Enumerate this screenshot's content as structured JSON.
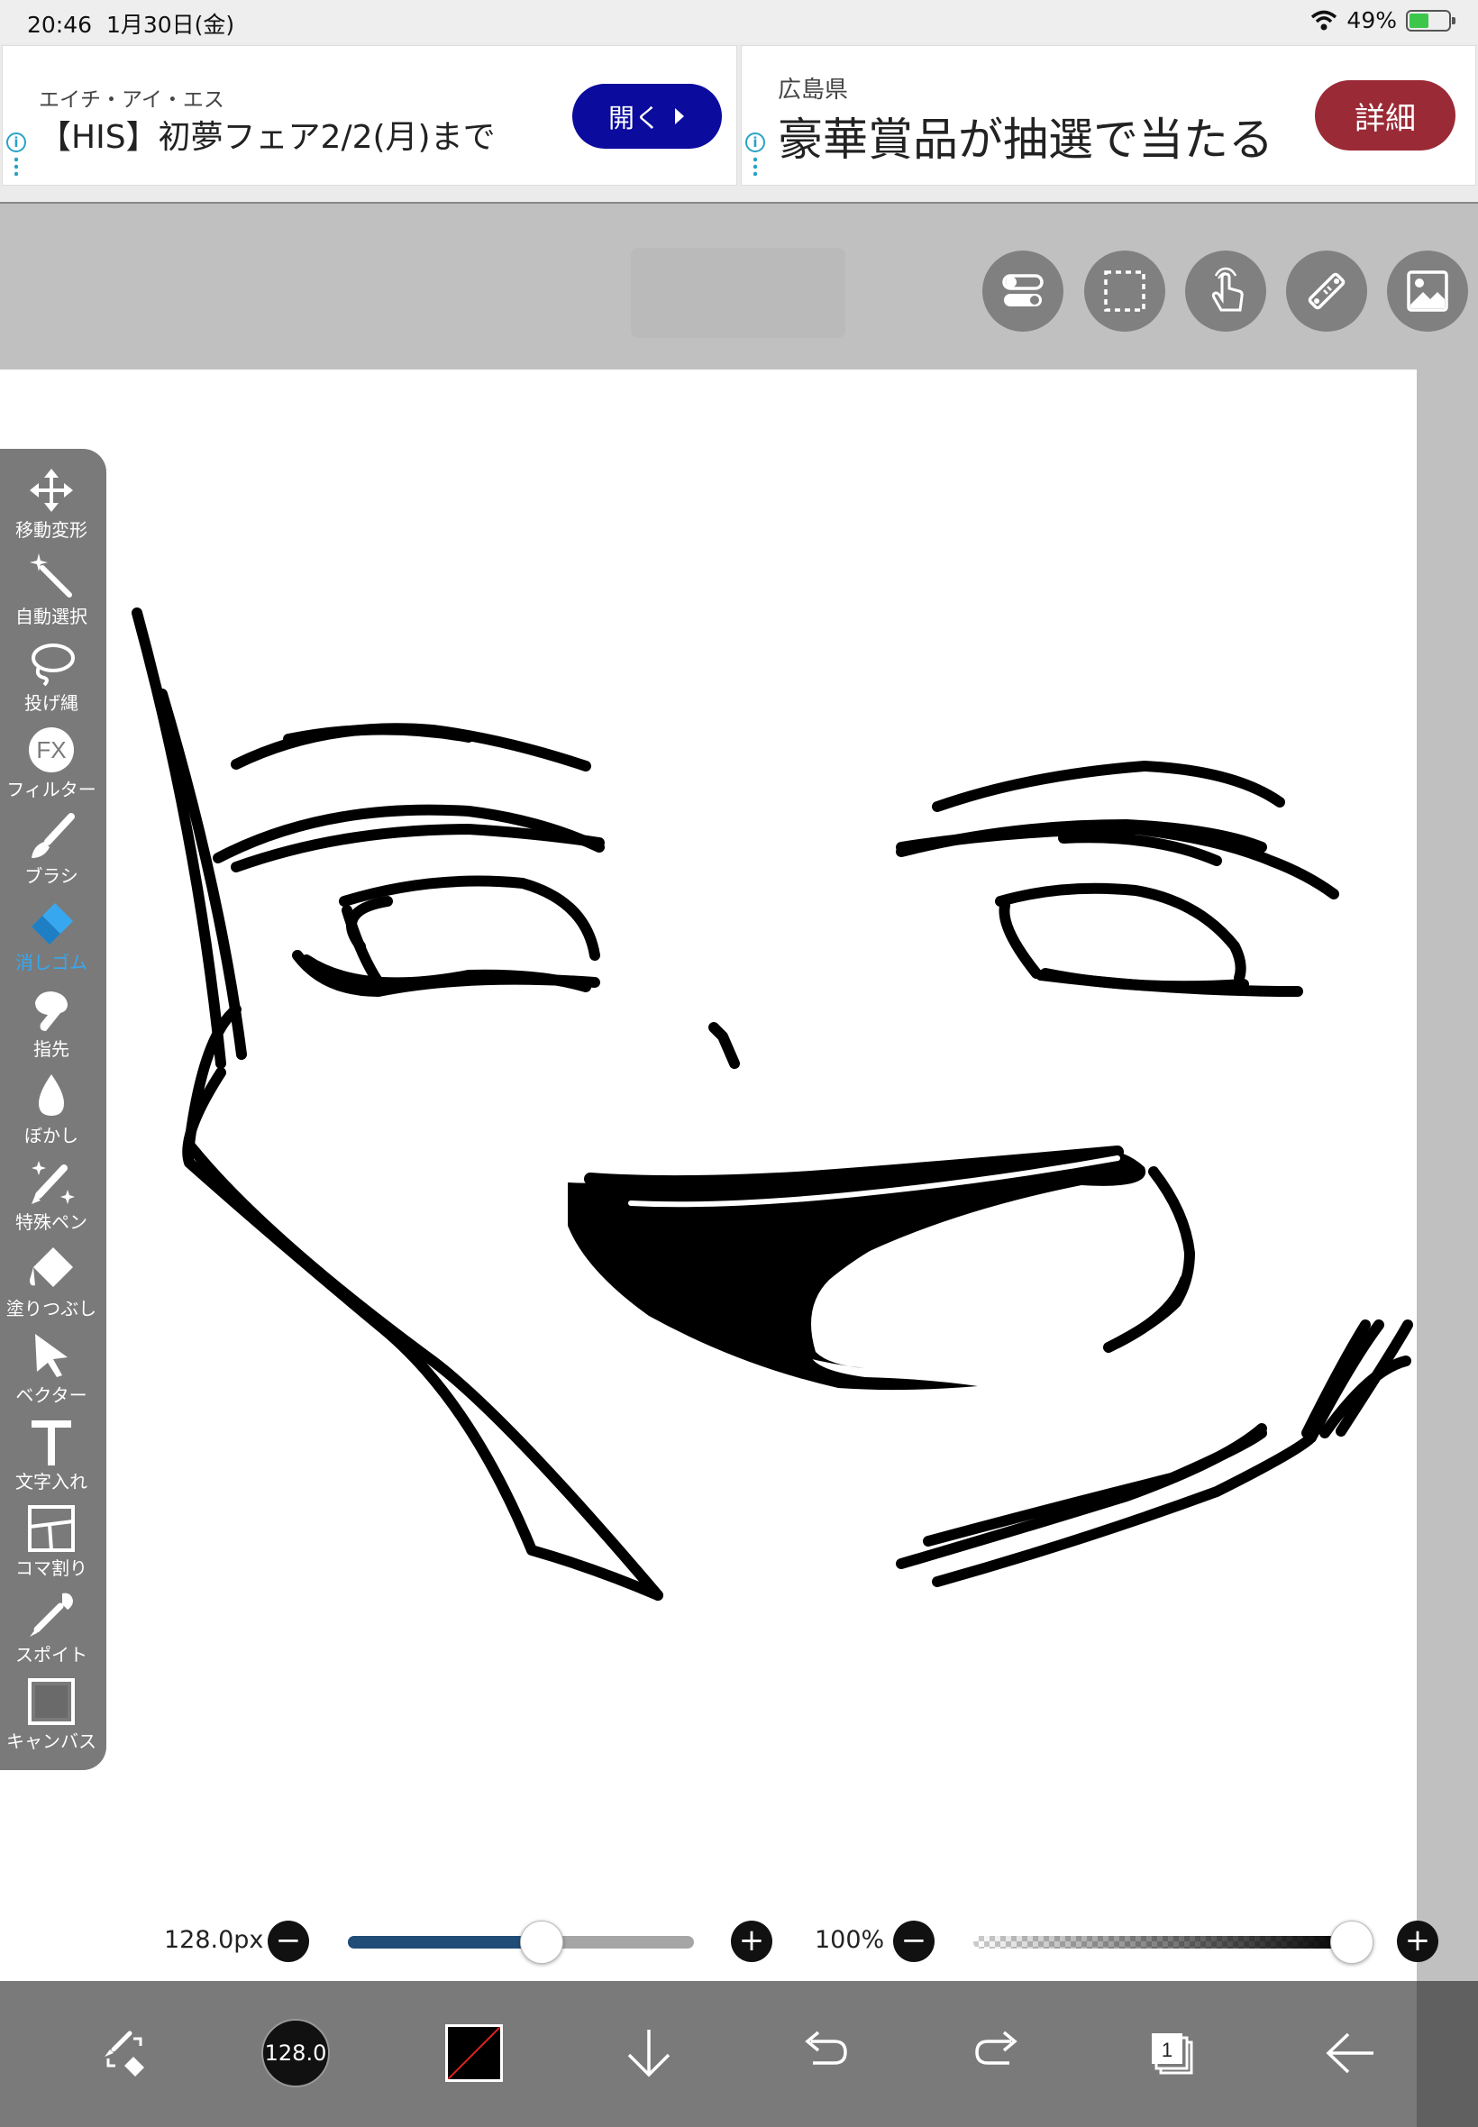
{
  "status": {
    "time": "20:46",
    "date": "1月30日(金)",
    "battery": "49%",
    "battery_level": 0.49
  },
  "ads": [
    {
      "subtitle": "エイチ・アイ・エス",
      "title": "【HIS】初夢フェア2/2(月)まで",
      "button": "開く",
      "button_color": "#0b0b9e"
    },
    {
      "subtitle": "広島県",
      "title": "豪華賞品が抽選で当たる",
      "button": "詳細",
      "button_color": "#9a2b36"
    }
  ],
  "top_tools": [
    {
      "icon": "toggle-icon"
    },
    {
      "icon": "selection-icon"
    },
    {
      "icon": "touch-icon"
    },
    {
      "icon": "ruler-icon"
    },
    {
      "icon": "image-icon"
    }
  ],
  "tools": [
    {
      "label": "移動変形",
      "icon": "move-icon"
    },
    {
      "label": "自動選択",
      "icon": "magic-wand-icon"
    },
    {
      "label": "投げ縄",
      "icon": "lasso-icon"
    },
    {
      "label": "フィルター",
      "icon": "fx-icon"
    },
    {
      "label": "ブラシ",
      "icon": "brush-icon"
    },
    {
      "label": "消しゴム",
      "icon": "eraser-icon",
      "active": true
    },
    {
      "label": "指先",
      "icon": "finger-icon"
    },
    {
      "label": "ぼかし",
      "icon": "blur-icon"
    },
    {
      "label": "特殊ペン",
      "icon": "special-pen-icon"
    },
    {
      "label": "塗りつぶし",
      "icon": "fill-icon"
    },
    {
      "label": "ベクター",
      "icon": "vector-icon"
    },
    {
      "label": "文字入れ",
      "icon": "text-icon"
    },
    {
      "label": "コマ割り",
      "icon": "panel-icon"
    },
    {
      "label": "スポイト",
      "icon": "eyedropper-icon"
    },
    {
      "label": "キャンバス",
      "icon": "canvas-icon"
    }
  ],
  "brush": {
    "size_label": "128.0px",
    "size_level": 0.56,
    "opacity_label": "100%",
    "opacity_level": 1.0
  },
  "bottom": {
    "brush_size": "128.0",
    "layer_count": "1",
    "accent": "#37a8f0"
  }
}
